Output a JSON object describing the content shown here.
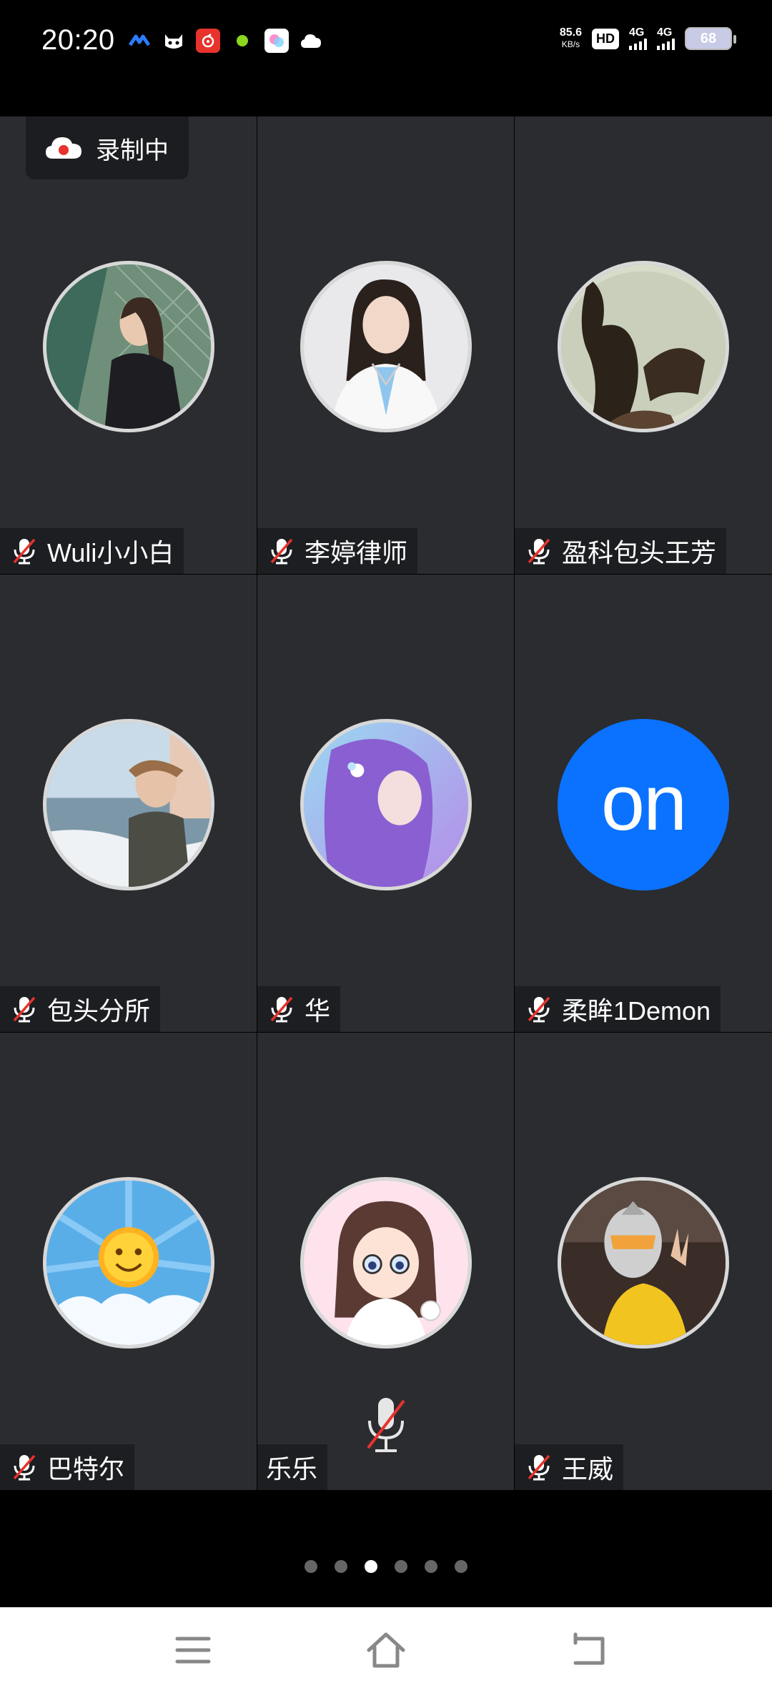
{
  "status_bar": {
    "time": "20:20",
    "net_speed_value": "85.6",
    "net_speed_unit": "KB/s",
    "hd_label": "HD",
    "sim1_type": "4G",
    "sim2_type": "4G",
    "battery_level": "68",
    "notification_icons": [
      "app-icon-blue",
      "cat-icon",
      "music-app-icon",
      "green-dot-icon",
      "gallery-app-icon",
      "cloud-icon"
    ]
  },
  "recording_badge": {
    "label": "录制中",
    "icon": "cloud-record-icon",
    "color": "#e8322c"
  },
  "participants": [
    {
      "name": "Wuli小小白",
      "muted": true
    },
    {
      "name": "李婷律师",
      "muted": true
    },
    {
      "name": "盈科包头王芳",
      "muted": true
    },
    {
      "name": "包头分所",
      "muted": true
    },
    {
      "name": "华",
      "muted": true
    },
    {
      "name": "柔眸1Demon",
      "muted": true,
      "avatar_text": "on",
      "avatar_color": "#0a72ff"
    },
    {
      "name": "巴特尔",
      "muted": true
    },
    {
      "name": "乐乐",
      "muted": true
    },
    {
      "name": "王威",
      "muted": true
    }
  ],
  "pager": {
    "page_count": 6,
    "active_page": 3
  },
  "nav_bar": {
    "buttons": [
      "menu-icon",
      "home-icon",
      "back-icon"
    ]
  }
}
